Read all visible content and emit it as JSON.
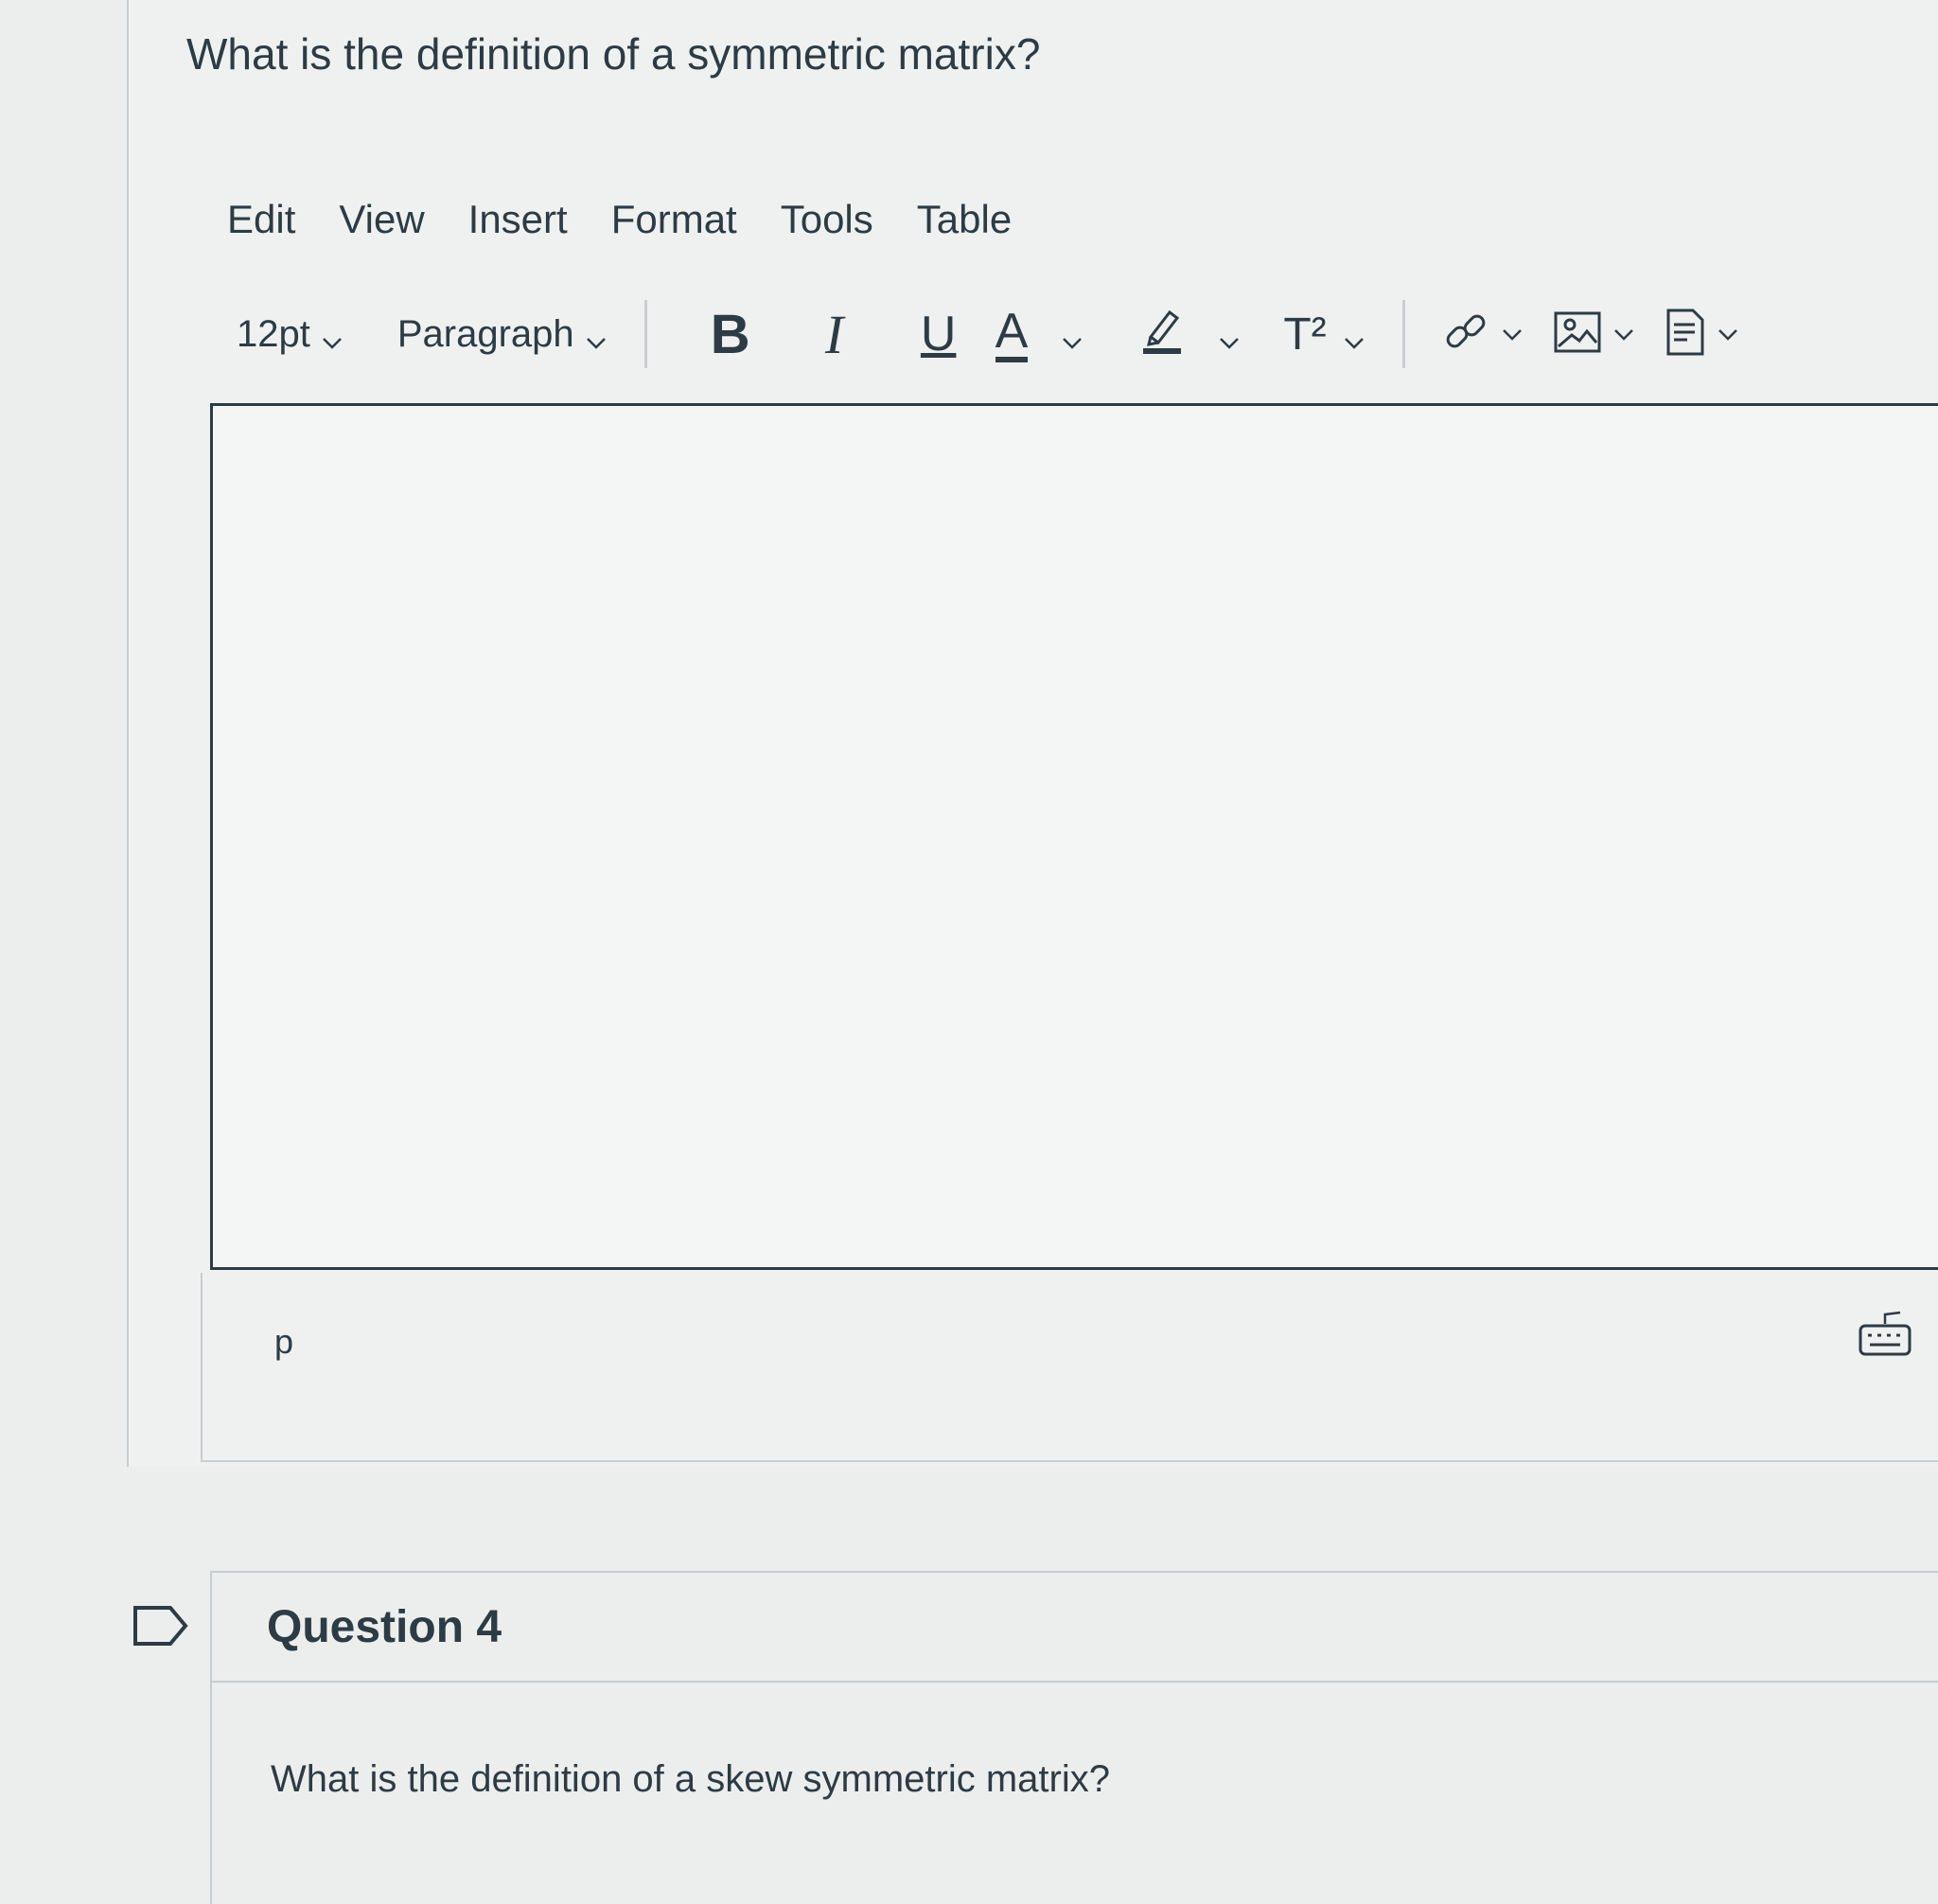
{
  "question3": {
    "text": "What is the definition of a symmetric matrix?"
  },
  "editor": {
    "menu": [
      "Edit",
      "View",
      "Insert",
      "Format",
      "Tools",
      "Table"
    ],
    "toolbar": {
      "font_size": "12pt",
      "block_format": "Paragraph",
      "bold": "B",
      "italic": "I",
      "underline": "U",
      "text_color": "A",
      "superscript": "T²"
    },
    "content": "",
    "status_path": "p"
  },
  "question4": {
    "title": "Question 4",
    "text": "What is the definition of a skew symmetric matrix?"
  }
}
